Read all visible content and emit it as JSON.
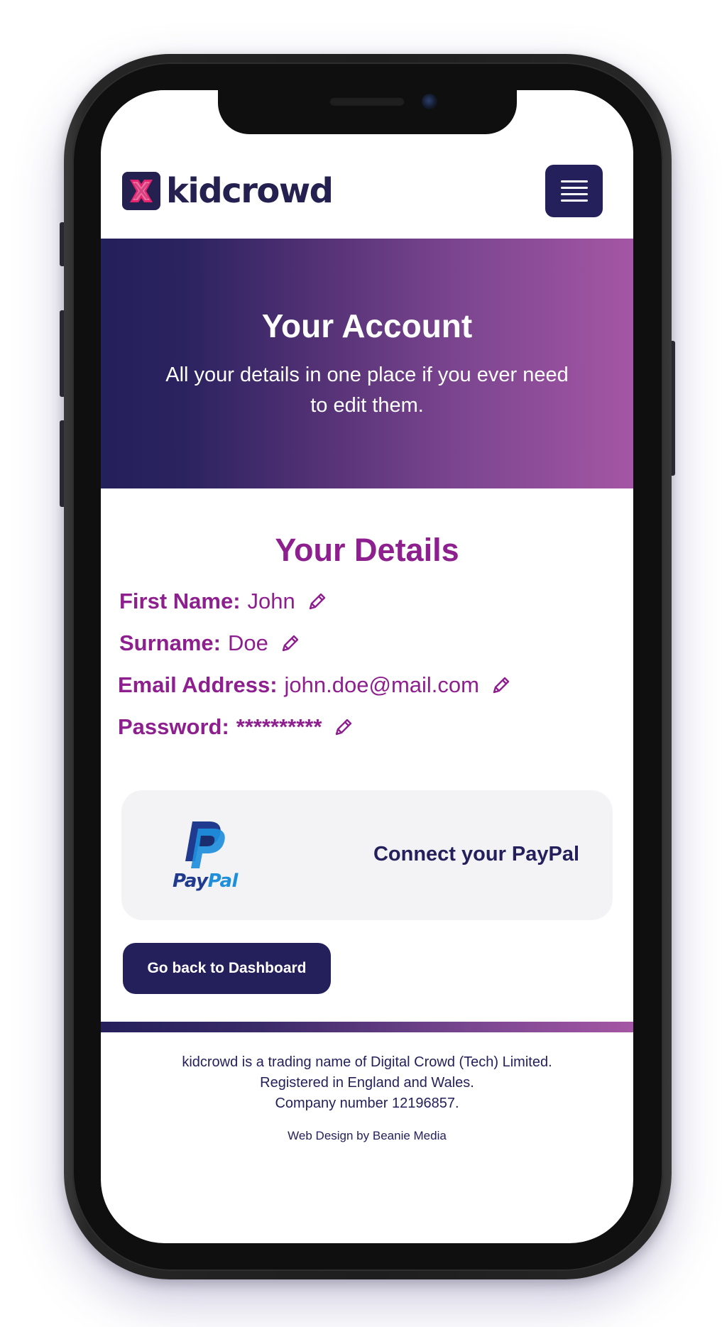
{
  "header": {
    "logo_text": "kidcrowd",
    "logo_icon": "kidcrowd-x-logo-icon",
    "menu_icon": "hamburger-menu-icon"
  },
  "hero": {
    "title": "Your Account",
    "subtitle": "All your details in one place if you ever need to edit them."
  },
  "details": {
    "title": "Your Details",
    "fields": [
      {
        "label": "First Name:",
        "value": "John"
      },
      {
        "label": "Surname:",
        "value": "Doe"
      },
      {
        "label": "Email Address:",
        "value": "john.doe@mail.com"
      },
      {
        "label": "Password:",
        "value": "**********"
      }
    ],
    "edit_icon": "pencil-edit-icon"
  },
  "paypal": {
    "brand_pay": "Pay",
    "brand_pal": "Pal",
    "action_label": "Connect your PayPal"
  },
  "actions": {
    "back_label": "Go back to Dashboard"
  },
  "footer": {
    "line1": "kidcrowd is a trading name of Digital Crowd (Tech) Limited.",
    "line2": "Registered in England and Wales.",
    "line3": "Company number 12196857.",
    "credit": "Web Design by Beanie Media"
  },
  "colors": {
    "navy": "#24205c",
    "purple": "#8d1f8f",
    "gradient_end": "#a456a4",
    "card_bg": "#f3f3f6"
  }
}
